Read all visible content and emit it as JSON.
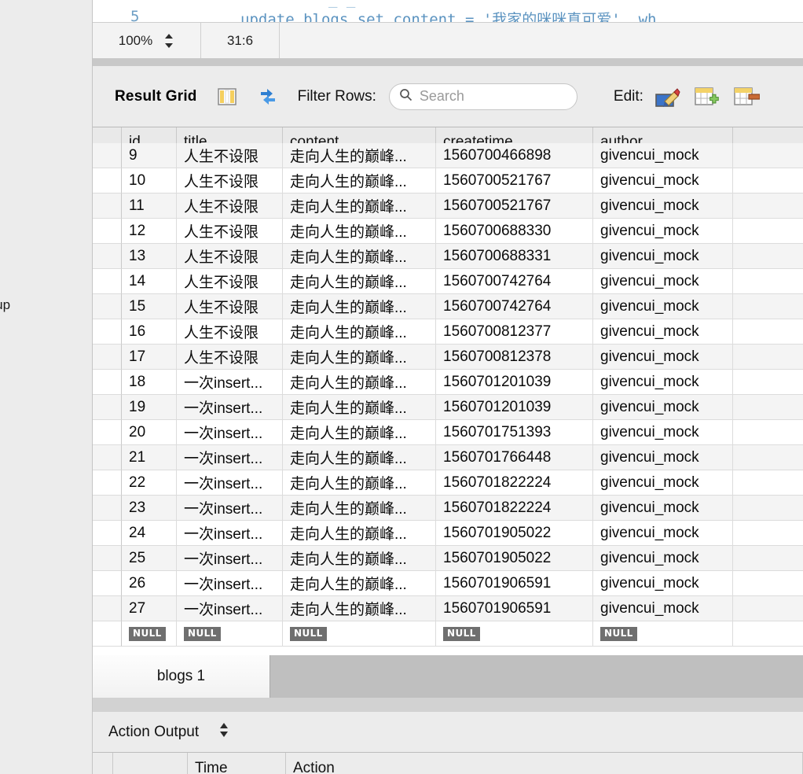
{
  "sidebar": {
    "truncated_label": "etup"
  },
  "editor": {
    "line_number": "5",
    "sql_line": "update blogs set content = '我家的咪咪真可爱', wh",
    "ghost_line": "_   _"
  },
  "statusbar": {
    "zoom": "100%",
    "cursor_position": "31:6",
    "stepper_icon": "stepper-updown-icon"
  },
  "toolbar": {
    "title": "Result Grid",
    "grid_icon": "grid-columns-icon",
    "refresh_icon": "refresh-arrows-icon",
    "filter_label": "Filter Rows:",
    "search": {
      "value": "",
      "placeholder": "Search",
      "icon": "search-icon"
    },
    "edit_label": "Edit:",
    "edit_icons": [
      "edit-pencil-icon",
      "insert-row-icon",
      "delete-row-icon"
    ]
  },
  "grid": {
    "columns": [
      "id",
      "title",
      "content",
      "createtime",
      "author"
    ],
    "rows": [
      {
        "id": "9",
        "title": "人生不设限",
        "content": "走向人生的巅峰...",
        "createtime": "1560700466898",
        "author": "givencui_mock"
      },
      {
        "id": "10",
        "title": "人生不设限",
        "content": "走向人生的巅峰...",
        "createtime": "1560700521767",
        "author": "givencui_mock"
      },
      {
        "id": "11",
        "title": "人生不设限",
        "content": "走向人生的巅峰...",
        "createtime": "1560700521767",
        "author": "givencui_mock"
      },
      {
        "id": "12",
        "title": "人生不设限",
        "content": "走向人生的巅峰...",
        "createtime": "1560700688330",
        "author": "givencui_mock"
      },
      {
        "id": "13",
        "title": "人生不设限",
        "content": "走向人生的巅峰...",
        "createtime": "1560700688331",
        "author": "givencui_mock"
      },
      {
        "id": "14",
        "title": "人生不设限",
        "content": "走向人生的巅峰...",
        "createtime": "1560700742764",
        "author": "givencui_mock"
      },
      {
        "id": "15",
        "title": "人生不设限",
        "content": "走向人生的巅峰...",
        "createtime": "1560700742764",
        "author": "givencui_mock"
      },
      {
        "id": "16",
        "title": "人生不设限",
        "content": "走向人生的巅峰...",
        "createtime": "1560700812377",
        "author": "givencui_mock"
      },
      {
        "id": "17",
        "title": "人生不设限",
        "content": "走向人生的巅峰...",
        "createtime": "1560700812378",
        "author": "givencui_mock"
      },
      {
        "id": "18",
        "title": "一次insert...",
        "content": "走向人生的巅峰...",
        "createtime": "1560701201039",
        "author": "givencui_mock"
      },
      {
        "id": "19",
        "title": "一次insert...",
        "content": "走向人生的巅峰...",
        "createtime": "1560701201039",
        "author": "givencui_mock"
      },
      {
        "id": "20",
        "title": "一次insert...",
        "content": "走向人生的巅峰...",
        "createtime": "1560701751393",
        "author": "givencui_mock"
      },
      {
        "id": "21",
        "title": "一次insert...",
        "content": "走向人生的巅峰...",
        "createtime": "1560701766448",
        "author": "givencui_mock"
      },
      {
        "id": "22",
        "title": "一次insert...",
        "content": "走向人生的巅峰...",
        "createtime": "1560701822224",
        "author": "givencui_mock"
      },
      {
        "id": "23",
        "title": "一次insert...",
        "content": "走向人生的巅峰...",
        "createtime": "1560701822224",
        "author": "givencui_mock"
      },
      {
        "id": "24",
        "title": "一次insert...",
        "content": "走向人生的巅峰...",
        "createtime": "1560701905022",
        "author": "givencui_mock"
      },
      {
        "id": "25",
        "title": "一次insert...",
        "content": "走向人生的巅峰...",
        "createtime": "1560701905022",
        "author": "givencui_mock"
      },
      {
        "id": "26",
        "title": "一次insert...",
        "content": "走向人生的巅峰...",
        "createtime": "1560701906591",
        "author": "givencui_mock"
      },
      {
        "id": "27",
        "title": "一次insert...",
        "content": "走向人生的巅峰...",
        "createtime": "1560701906591",
        "author": "givencui_mock"
      }
    ],
    "null_row": {
      "label": "NULL"
    }
  },
  "result_tabs": {
    "active": "blogs 1"
  },
  "action_output": {
    "label": "Action Output",
    "stepper_icon": "stepper-updown-icon",
    "columns": [
      "Time",
      "Action"
    ]
  },
  "colors": {
    "chrome": "#ececec",
    "grid_header": "#e9e9e9",
    "row_alt": "#f4f4f4",
    "null_badge": "#6f6f6f",
    "sql_text": "#5b93c0",
    "tabstrip": "#bfbfbf"
  }
}
